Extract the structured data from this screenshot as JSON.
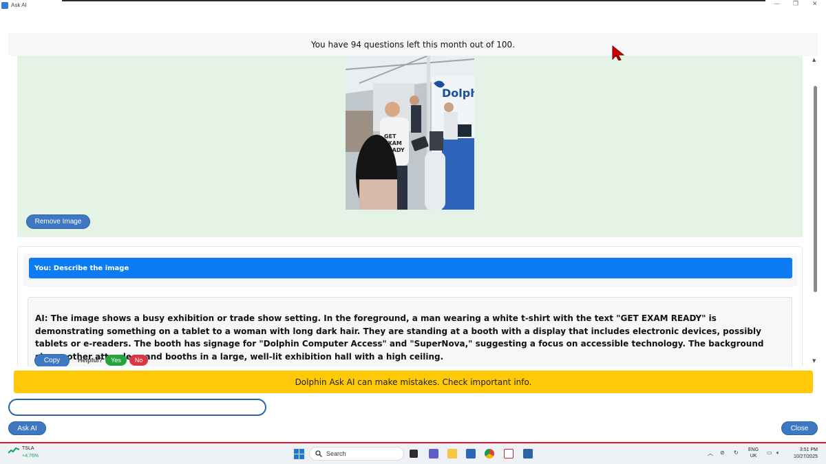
{
  "window": {
    "title": "Ask AI",
    "controls": [
      "—",
      "❐",
      "✕"
    ]
  },
  "quota_text": "You have 94 questions left this month out of 100.",
  "image_panel": {
    "remove_label": "Remove Image",
    "photo_text": "GET EXAM READY",
    "booth_text": "Dolph"
  },
  "chat": {
    "user_message": "You: Describe the image",
    "ai_label": "AI:",
    "ai_message": "The image shows a busy exhibition or trade show setting. In the foreground, a man wearing a white t-shirt with the text \"GET EXAM READY\" is demonstrating something on a tablet to a woman with long dark hair. They are standing at a booth with a display that includes electronic devices, possibly tablets or e-readers. The booth has signage for \"Dolphin Computer Access\" and \"SuperNova,\" suggesting a focus on accessible technology. The background shows other attendees and booths in a large, well-lit exhibition hall with a high ceiling.",
    "copy_label": "Copy",
    "helpful_label": "Helpful?",
    "yes_label": "Yes",
    "no_label": "No"
  },
  "disclaimer": "Dolphin Ask AI can make mistakes. Check important info.",
  "input": {
    "value": "",
    "placeholder": ""
  },
  "ask_label": "Ask AI",
  "close_label": "Close",
  "taskbar": {
    "ticker_name": "TSLA",
    "ticker_change": "+4.76%",
    "search_label": "Search",
    "language_line1": "ENG",
    "language_line2": "UK",
    "time": "3:51 PM",
    "date": "10/27/2025"
  },
  "colors": {
    "accent_blue": "#3d79c2",
    "user_bar": "#0d7cf2",
    "image_panel_bg": "#e4f3e6",
    "disclaimer_bg": "#ffc908",
    "yes_green": "#25a33c",
    "no_red": "#dc3545",
    "taskbar_red_line": "#e81123"
  }
}
